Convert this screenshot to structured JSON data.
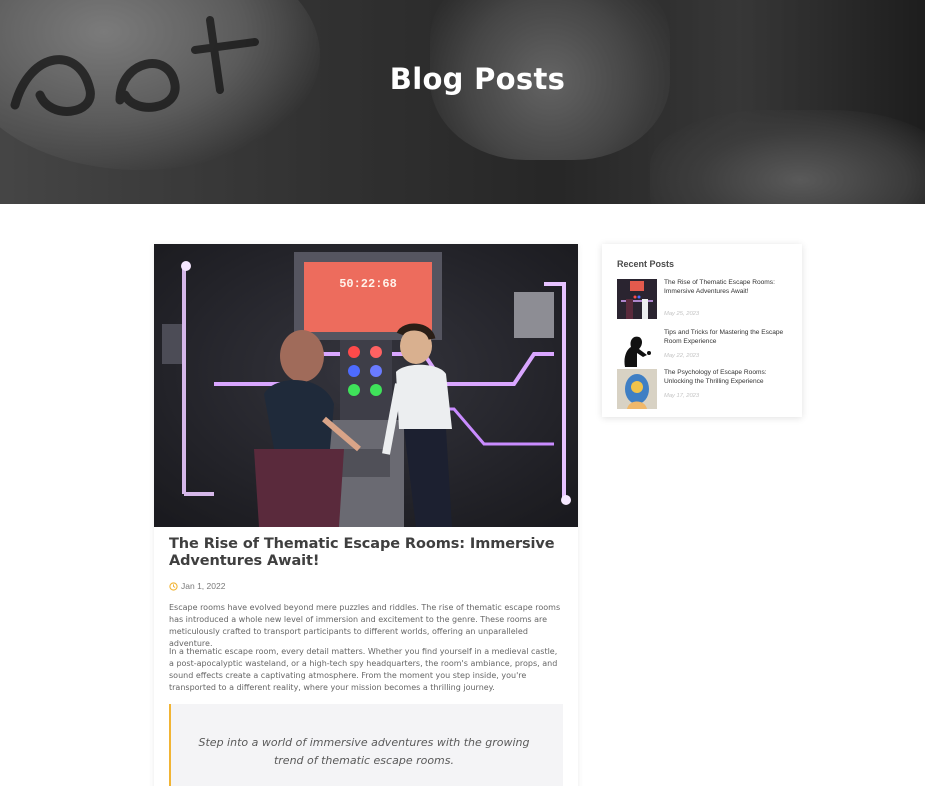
{
  "hero": {
    "title": "Blog Posts"
  },
  "article": {
    "title": "The Rise of Thematic Escape Rooms: Immersive Adventures Await!",
    "date": "Jan 1, 2022",
    "date_icon": "clock-icon",
    "paragraphs": [
      "Escape rooms have evolved beyond mere puzzles and riddles. The rise of thematic escape rooms has introduced a whole new level of immersion and excitement to the genre. These rooms are meticulously crafted to transport participants to different worlds, offering an unparalleled adventure.",
      "In a thematic escape room, every detail matters. Whether you find yourself in a medieval castle, a post-apocalyptic wasteland, or a high-tech spy headquarters, the room's ambiance, props, and sound effects create a captivating atmosphere. From the moment you step inside, you're transported to a different reality, where your mission becomes a thrilling journey."
    ],
    "quote": "Step into a world of immersive adventures with the growing trend of thematic escape rooms.",
    "image_screen_text": "50:22:68"
  },
  "sidebar": {
    "title": "Recent Posts",
    "posts": [
      {
        "title": "The Rise of Thematic Escape Rooms: Immersive Adventures Await!",
        "date": "May 25, 2023"
      },
      {
        "title": "Tips and Tricks for Mastering the Escape Room Experience",
        "date": "May 22, 2023"
      },
      {
        "title": "The Psychology of Escape Rooms: Unlocking the Thrilling Experience",
        "date": "May 17, 2023"
      }
    ]
  },
  "colors": {
    "accent": "#f1b434",
    "quote_bg": "#f4f4f6",
    "hero_text": "#ffffff"
  }
}
